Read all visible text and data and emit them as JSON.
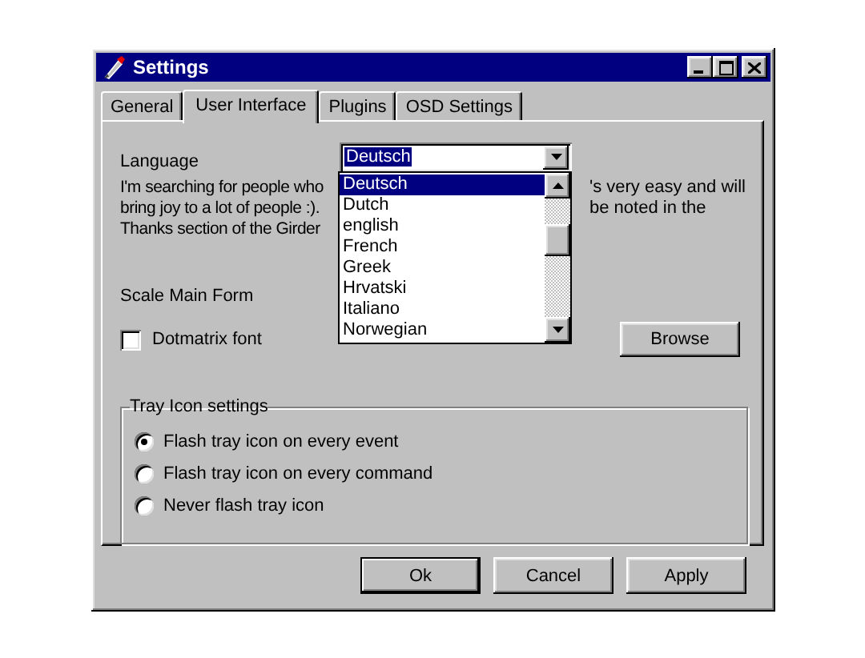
{
  "window": {
    "title": "Settings"
  },
  "tabs": [
    {
      "label": "General",
      "selected": false
    },
    {
      "label": "User Interface",
      "selected": true
    },
    {
      "label": "Plugins",
      "selected": false
    },
    {
      "label": "OSD Settings",
      "selected": false
    }
  ],
  "language": {
    "label": "Language",
    "value": "Deutsch",
    "expanded": true,
    "options": [
      {
        "label": "Deutsch",
        "selected": true
      },
      {
        "label": "Dutch",
        "selected": false
      },
      {
        "label": "english",
        "selected": false
      },
      {
        "label": "French",
        "selected": false
      },
      {
        "label": "Greek",
        "selected": false
      },
      {
        "label": "Hrvatski",
        "selected": false
      },
      {
        "label": "Italiano",
        "selected": false
      },
      {
        "label": "Norwegian",
        "selected": false
      }
    ]
  },
  "description": {
    "left_lines": [
      "I'm searching for people who",
      "bring joy to a lot of people :).",
      "Thanks section of the Girder"
    ],
    "right_lines": [
      "'s very easy and will",
      "be noted in the"
    ]
  },
  "scale_label": "Scale Main Form",
  "dotmatrix": {
    "label": "Dotmatrix font",
    "checked": false
  },
  "browse_button": "Browse",
  "tray_group": {
    "title": "Tray Icon settings",
    "options": [
      {
        "label": "Flash tray icon on every event",
        "selected": true
      },
      {
        "label": "Flash tray icon on every command",
        "selected": false
      },
      {
        "label": "Never flash tray icon",
        "selected": false
      }
    ]
  },
  "buttons": [
    {
      "label": "Ok",
      "default": true
    },
    {
      "label": "Cancel",
      "default": false
    },
    {
      "label": "Apply",
      "default": false
    }
  ]
}
